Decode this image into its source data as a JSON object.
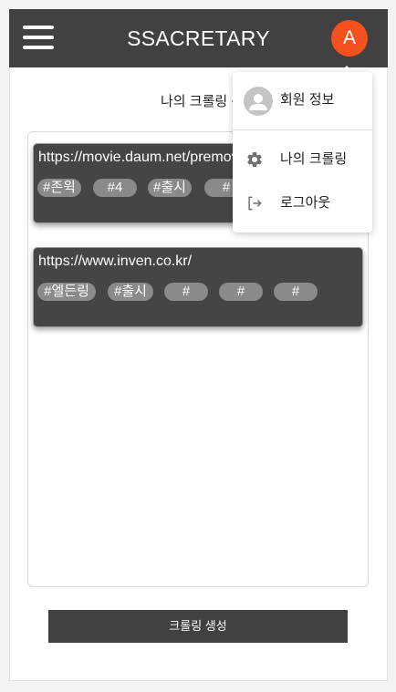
{
  "app": {
    "brand": "SSACRETARY",
    "avatar_initial": "A"
  },
  "page": {
    "title": "나의 크롤링 목록"
  },
  "crawls": [
    {
      "url": "https://movie.daum.net/premovie/released",
      "tags": [
        "#존윅",
        "#4",
        "#출시",
        "#",
        "#"
      ]
    },
    {
      "url": "https://www.inven.co.kr/",
      "tags": [
        "#엘든링",
        "#출시",
        "#",
        "#",
        "#"
      ]
    }
  ],
  "create_button": {
    "label": "크롤링 생성"
  },
  "user_menu": {
    "profile_label": "회원 정보",
    "items": [
      {
        "label": "나의 크롤링",
        "icon": "gear-icon"
      },
      {
        "label": "로그아웃",
        "icon": "logout-icon"
      }
    ]
  },
  "colors": {
    "appbar": "#414141",
    "avatar": "#f4511e",
    "card": "#454545",
    "tag": "#8a8a8a"
  }
}
